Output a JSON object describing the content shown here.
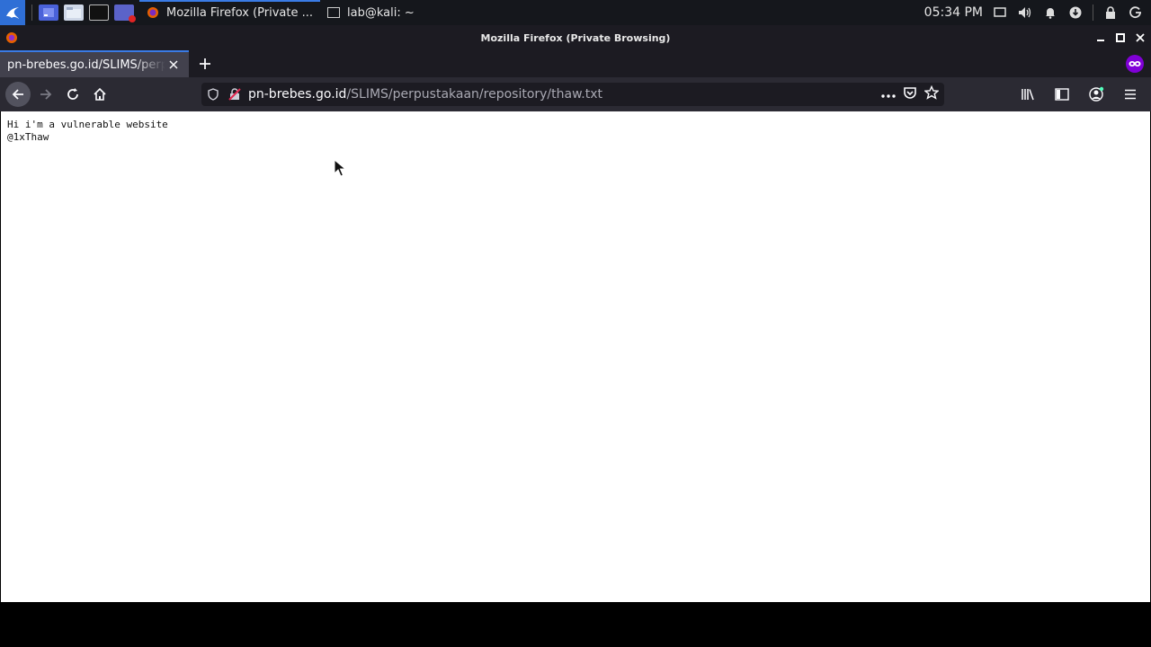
{
  "taskbar": {
    "tasks": [
      {
        "label": "Mozilla Firefox (Private ...",
        "active": true
      },
      {
        "label": "lab@kali: ~",
        "active": false
      }
    ],
    "clock": "05:34 PM"
  },
  "window": {
    "title": "Mozilla Firefox (Private Browsing)"
  },
  "tabs": [
    {
      "title": "pn-brebes.go.id/SLIMS/perpustakaan/repository/thaw.txt"
    }
  ],
  "urlbar": {
    "domain": "pn-brebes.go.id",
    "path": "/SLIMS/perpustakaan/repository/thaw.txt"
  },
  "page": {
    "lines": [
      "Hi i'm a vulnerable website",
      "@1xThaw"
    ]
  },
  "colors": {
    "accent": "#3a7be5",
    "private": "#8000d7",
    "toolbar": "#2b2a33"
  }
}
